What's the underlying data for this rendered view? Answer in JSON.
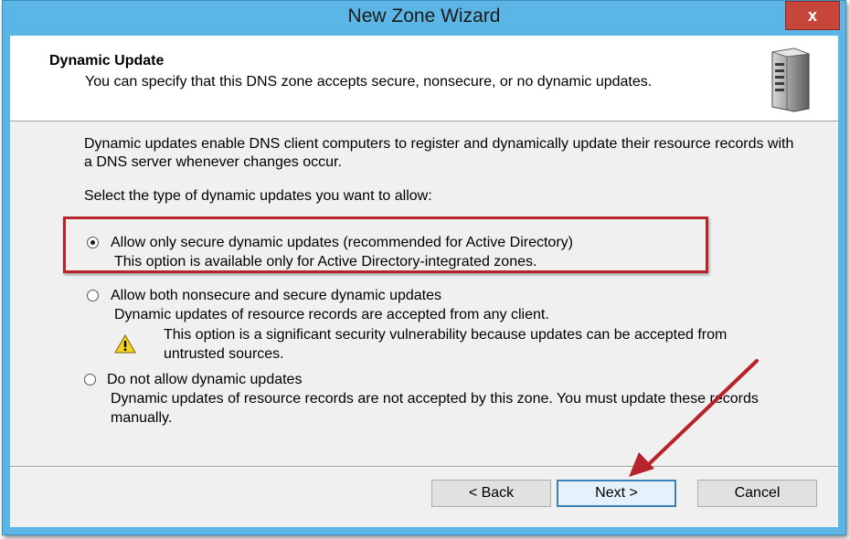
{
  "window": {
    "title": "New Zone Wizard",
    "close_label": "x"
  },
  "header": {
    "title": "Dynamic Update",
    "subtitle": "You can specify that this DNS zone accepts secure, nonsecure, or no dynamic updates.",
    "icon": "server-icon"
  },
  "content": {
    "description": "Dynamic updates enable DNS client computers to register and dynamically update their resource records with a DNS server whenever changes occur.",
    "prompt": "Select the type of dynamic updates you want to allow:",
    "options": [
      {
        "label": "Allow only secure dynamic updates (recommended for Active Directory)",
        "detail": "This option is available only for Active Directory-integrated zones.",
        "selected": true
      },
      {
        "label": "Allow both nonsecure and secure dynamic updates",
        "detail": "Dynamic updates of resource records are accepted from any client.",
        "warning": "This option is a significant security vulnerability because updates can be accepted from untrusted sources.",
        "selected": false
      },
      {
        "label": "Do not allow dynamic updates",
        "detail": "Dynamic updates of resource records are not accepted by this zone. You must update these records manually.",
        "selected": false
      }
    ],
    "warning_icon": "warning-icon"
  },
  "buttons": {
    "back": "< Back",
    "next": "Next >",
    "cancel": "Cancel"
  },
  "colors": {
    "titlebar": "#5bb6e6",
    "close_button": "#c7463b",
    "highlight_box": "#b8222a",
    "annotation_arrow": "#b8222a"
  }
}
